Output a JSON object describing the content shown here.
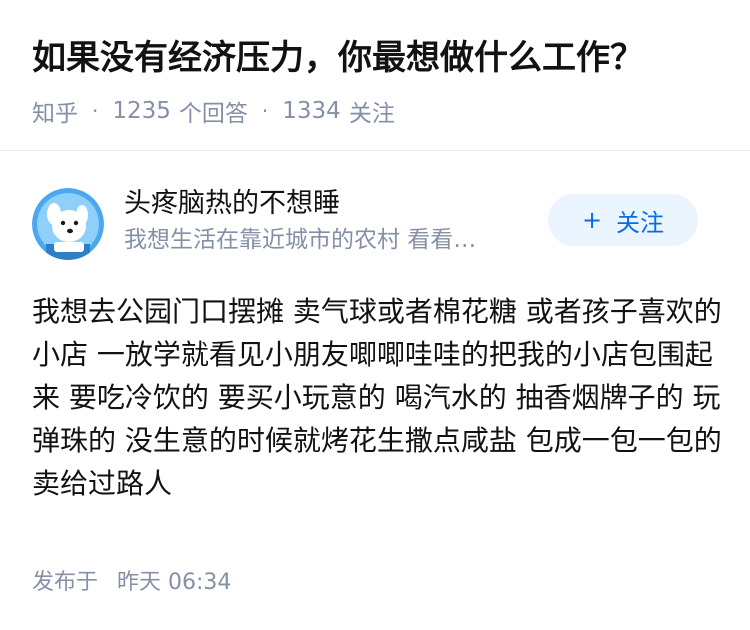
{
  "question": {
    "title": "如果没有经济压力，你最想做什么工作？",
    "source": "知乎",
    "answer_count": "1235",
    "answer_label": "个回答",
    "follower_count": "1334",
    "follower_label": "关注",
    "separator": "·"
  },
  "author": {
    "name": "头疼脑热的不想睡",
    "bio": "我想生活在靠近城市的农村 看看…",
    "avatar_icon": "dog-avatar-icon",
    "follow_icon": "+",
    "follow_label": "关注"
  },
  "answer": {
    "content": "我想去公园门口摆摊 卖气球或者棉花糖 或者孩子喜欢的小店 一放学就看见小朋友唧唧哇哇的把我的小店包围起来 要吃冷饮的 要买小玩意的 喝汽水的 抽香烟牌子的 玩弹珠的 没生意的时候就烤花生撒点咸盐 包成一包一包的卖给过路人",
    "published_label": "发布于",
    "published_time": "昨天 06:34"
  },
  "colors": {
    "primary_text": "#121212",
    "secondary_text": "#8590a6",
    "brand_blue": "#056de8",
    "follow_bg": "#ebf5ff",
    "avatar_bg": "#4aa8ee"
  }
}
